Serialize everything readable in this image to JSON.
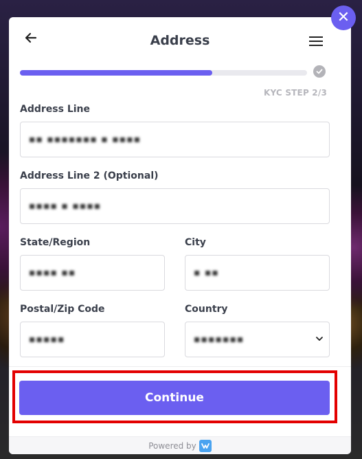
{
  "modal": {
    "title": "Address",
    "progress_fraction": 0.67,
    "step_label": "KYC STEP 2/3",
    "close_symbol": "✕"
  },
  "form": {
    "address_line_label": "Address Line",
    "address_line_value": "▪▪ ▪▪▪▪▪▪▪ ▪ ▪▪▪▪",
    "address_line2_label": "Address Line 2 (Optional)",
    "address_line2_value": "▪▪▪▪ ▪ ▪▪▪▪",
    "state_label": "State/Region",
    "state_value": "▪▪▪▪ ▪▪",
    "city_label": "City",
    "city_value": "▪ ▪▪",
    "postal_label": "Postal/Zip Code",
    "postal_value": "▪▪▪▪▪",
    "country_label": "Country",
    "country_value": "▪▪▪▪▪▪▪"
  },
  "actions": {
    "continue_label": "Continue"
  },
  "footer": {
    "powered_by": "Powered by"
  },
  "colors": {
    "accent": "#6b5ff0",
    "highlight": "#e30000"
  },
  "icons": [
    "back-arrow-icon",
    "hamburger-menu-icon",
    "check-circle-icon",
    "close-icon",
    "chevron-down-icon",
    "brand-logo-icon"
  ]
}
